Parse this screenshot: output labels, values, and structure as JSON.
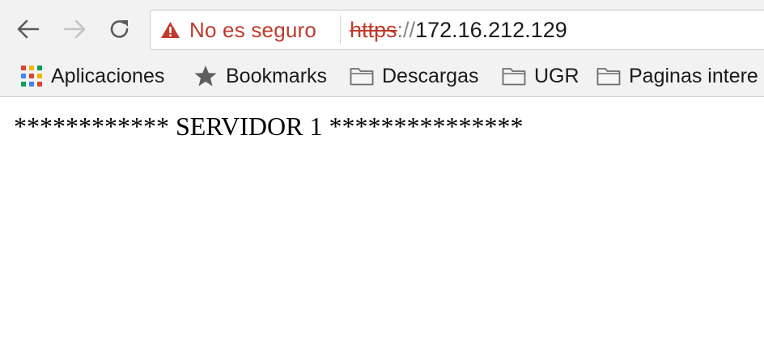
{
  "browser": {
    "security_text": "No es seguro",
    "url_scheme": "https",
    "url_separator": "://",
    "url_host": "172.16.212.129",
    "colors": {
      "warning": "#c0392b",
      "toolbar_bg": "#f2f2f2"
    }
  },
  "bookmarks": {
    "items": [
      {
        "label": "Aplicaciones",
        "icon": "apps-grid-icon"
      },
      {
        "label": "Bookmarks",
        "icon": "star-icon"
      },
      {
        "label": "Descargas",
        "icon": "folder-icon"
      },
      {
        "label": "UGR",
        "icon": "folder-icon"
      },
      {
        "label": "Paginas intere",
        "icon": "folder-icon"
      }
    ]
  },
  "page": {
    "text": "************ SERVIDOR 1 ***************"
  }
}
